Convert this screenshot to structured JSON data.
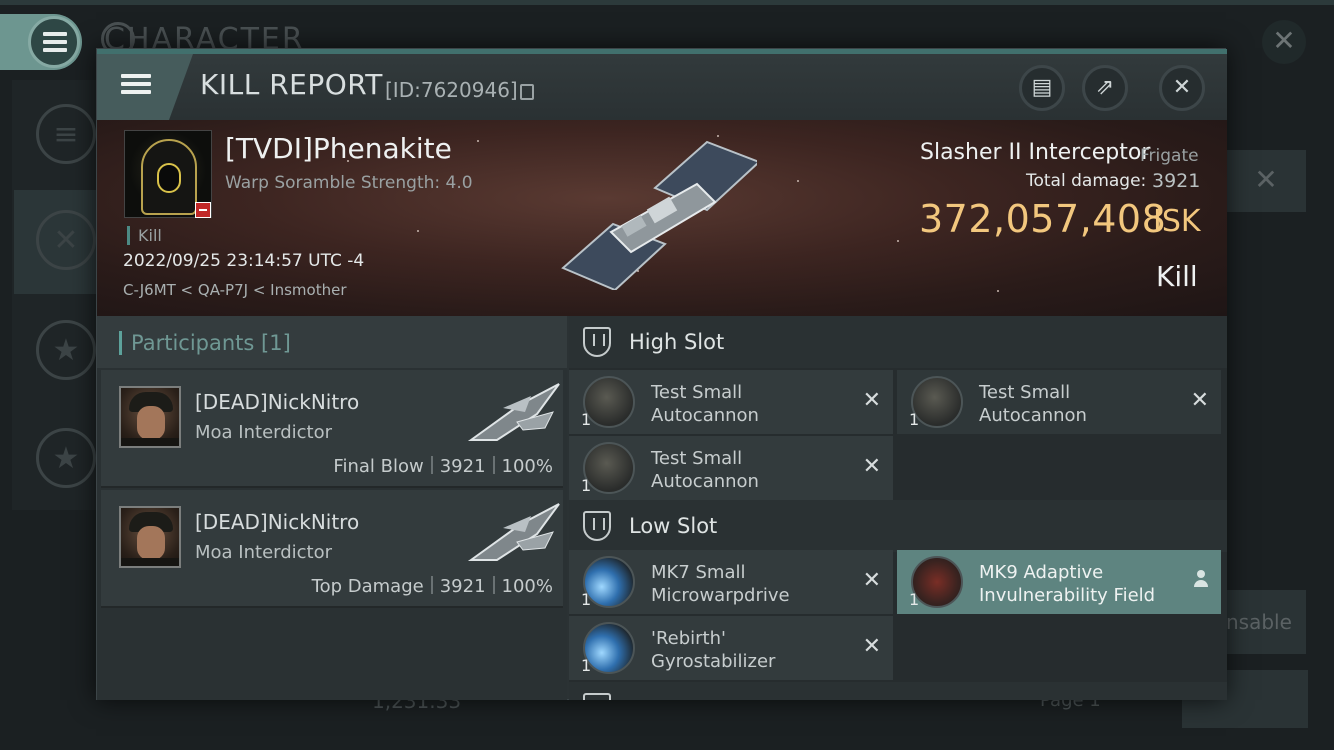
{
  "background": {
    "title": "CHARACTER",
    "right_button_label": "nsable",
    "bottom_value": "1,231.33",
    "page_label": "Page 1"
  },
  "header": {
    "title": "KILL REPORT",
    "id_label": "[ID:7620946]"
  },
  "victim": {
    "name": "[TVDI]Phenakite",
    "subtitle": "Warp Soramble Strength: 4.0",
    "status": "Kill",
    "datetime": "2022/09/25 23:14:57 UTC -4",
    "location": "C-J6MT < QA-P7J < Insmother",
    "ship_name": "Slasher II Interceptor",
    "ship_class": "Frigate",
    "total_damage_label": "Total damage:",
    "total_damage": "3921",
    "isk_value": "372,057,408",
    "isk_unit": "ISK",
    "result": "Kill"
  },
  "participants": {
    "title": "Participants [1]",
    "items": [
      {
        "name": "[DEAD]NickNitro",
        "ship": "Moa Interdictor",
        "role": "Final Blow",
        "damage": "3921",
        "percent": "100%"
      },
      {
        "name": "[DEAD]NickNitro",
        "ship": "Moa Interdictor",
        "role": "Top Damage",
        "damage": "3921",
        "percent": "100%"
      }
    ]
  },
  "fitting": {
    "high_slot": {
      "title": "High Slot",
      "modules": [
        {
          "qty": "1",
          "name_line1": "Test Small",
          "name_line2": "Autocannon",
          "icon": "autocannon-icon"
        },
        {
          "qty": "1",
          "name_line1": "Test Small",
          "name_line2": "Autocannon",
          "icon": "autocannon-icon"
        },
        {
          "qty": "1",
          "name_line1": "Test Small",
          "name_line2": "Autocannon",
          "icon": "autocannon-icon"
        }
      ]
    },
    "low_slot": {
      "title": "Low Slot",
      "modules": [
        {
          "qty": "1",
          "name_line1": "MK7 Small",
          "name_line2": "Microwarpdrive",
          "icon": "microwarpdrive-icon"
        },
        {
          "qty": "1",
          "name_line1": "MK9 Adaptive",
          "name_line2": "Invulnerability Field",
          "icon": "shield-module-icon"
        },
        {
          "qty": "1",
          "name_line1": "'Rebirth'",
          "name_line2": "Gyrostabilizer",
          "icon": "gyrostabilizer-icon"
        }
      ]
    }
  },
  "colors": {
    "accent": "#41706d",
    "isk": "#f2c77e",
    "selected": "#5e8480"
  }
}
